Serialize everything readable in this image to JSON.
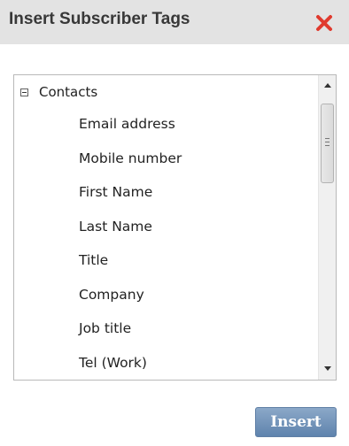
{
  "dialog": {
    "title": "Insert Subscriber Tags",
    "close_icon": "close-x-icon",
    "close_color": "#e03a2e"
  },
  "tree": {
    "toggle_icon": "minus-box-icon",
    "root_label": "Contacts",
    "items": [
      {
        "label": "Email address"
      },
      {
        "label": "Mobile number"
      },
      {
        "label": "First Name"
      },
      {
        "label": "Last Name"
      },
      {
        "label": "Title"
      },
      {
        "label": "Company"
      },
      {
        "label": "Job title"
      },
      {
        "label": "Tel (Work)"
      }
    ]
  },
  "scrollbar": {
    "up_icon": "triangle-up-icon",
    "down_icon": "triangle-down-icon"
  },
  "actions": {
    "insert_label": "Insert",
    "insert_color": "#6a8ab2"
  }
}
